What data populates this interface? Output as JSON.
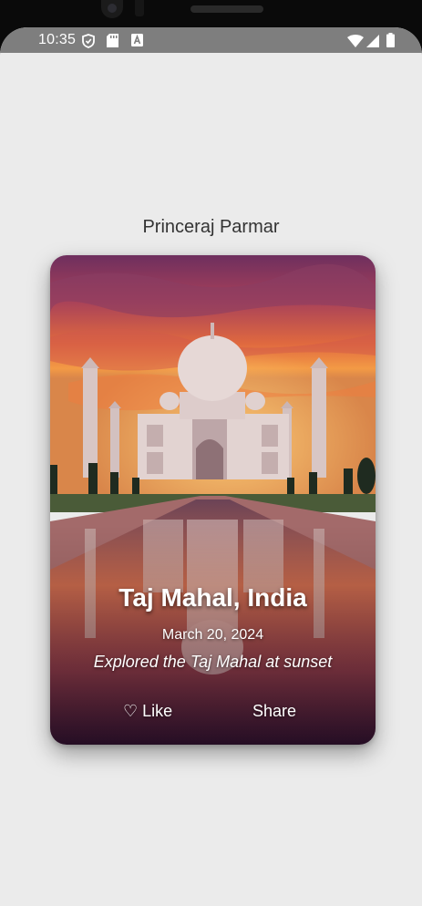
{
  "status_bar": {
    "time": "10:35"
  },
  "header": {
    "title": "Princeraj Parmar"
  },
  "card": {
    "title": "Taj Mahal, India",
    "date": "March 20, 2024",
    "description": "Explored the Taj Mahal at sunset",
    "like_icon": "♡",
    "like_label": "Like",
    "share_label": "Share"
  }
}
